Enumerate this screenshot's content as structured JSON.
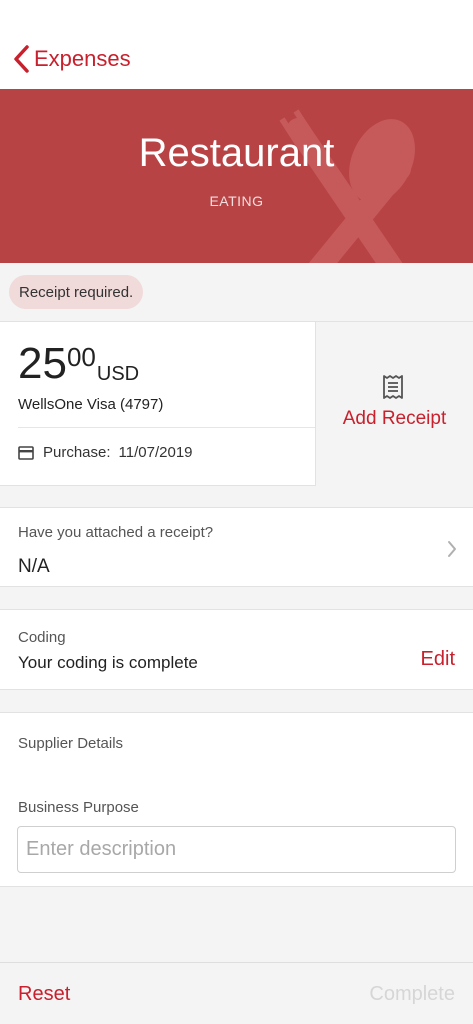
{
  "nav": {
    "back_label": "Expenses"
  },
  "header": {
    "title": "Restaurant",
    "category": "EATING"
  },
  "alert": {
    "text": "Receipt required."
  },
  "transaction": {
    "amount_int": "25",
    "amount_dec": "00",
    "currency": "USD",
    "card": "WellsOne Visa (4797)",
    "purchase_label": "Purchase:",
    "purchase_date": "11/07/2019"
  },
  "receipt": {
    "add_label": "Add Receipt"
  },
  "receipt_question": {
    "label": "Have you attached a receipt?",
    "value": "N/A"
  },
  "coding": {
    "label": "Coding",
    "status": "Your coding is complete",
    "edit_label": "Edit"
  },
  "supplier": {
    "label": "Supplier Details"
  },
  "purpose": {
    "label": "Business Purpose",
    "placeholder": "Enter description"
  },
  "footer": {
    "reset_label": "Reset",
    "complete_label": "Complete"
  },
  "colors": {
    "accent": "#c8202c",
    "header_bg": "#b74345"
  }
}
